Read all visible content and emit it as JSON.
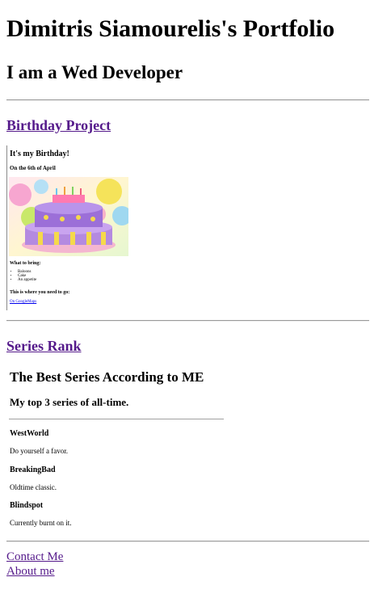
{
  "header": {
    "title": "Dimitris Siamourelis's Portfolio",
    "subtitle": "I am a Wed Developer"
  },
  "projects": [
    {
      "link_label": "Birthday Project",
      "preview": {
        "title": "It's my Birthday!",
        "date": "On the 6th of April",
        "image_icon": "birthday-cake-image",
        "what_to_bring": "What to bring:",
        "items": [
          "Baloons",
          "Cake",
          "An appetite"
        ],
        "where": "This is where you need to go:",
        "map_link": "On GoogleMaps"
      }
    },
    {
      "link_label": "Series Rank",
      "preview": {
        "title": "The Best Series According to ME",
        "subtitle": "My top 3 series of all-time.",
        "series": [
          {
            "name": "WestWorld",
            "desc": "Do yourself a favor."
          },
          {
            "name": "BreakingBad",
            "desc": "Oldtime classic."
          },
          {
            "name": "Blindspot",
            "desc": "Currently burnt on it."
          }
        ]
      }
    }
  ],
  "footer": {
    "links": [
      "Contact Me",
      "About me"
    ]
  },
  "colors": {
    "visited_link": "#551a8b",
    "link": "#0000ee",
    "rule": "#9a9a9a"
  }
}
